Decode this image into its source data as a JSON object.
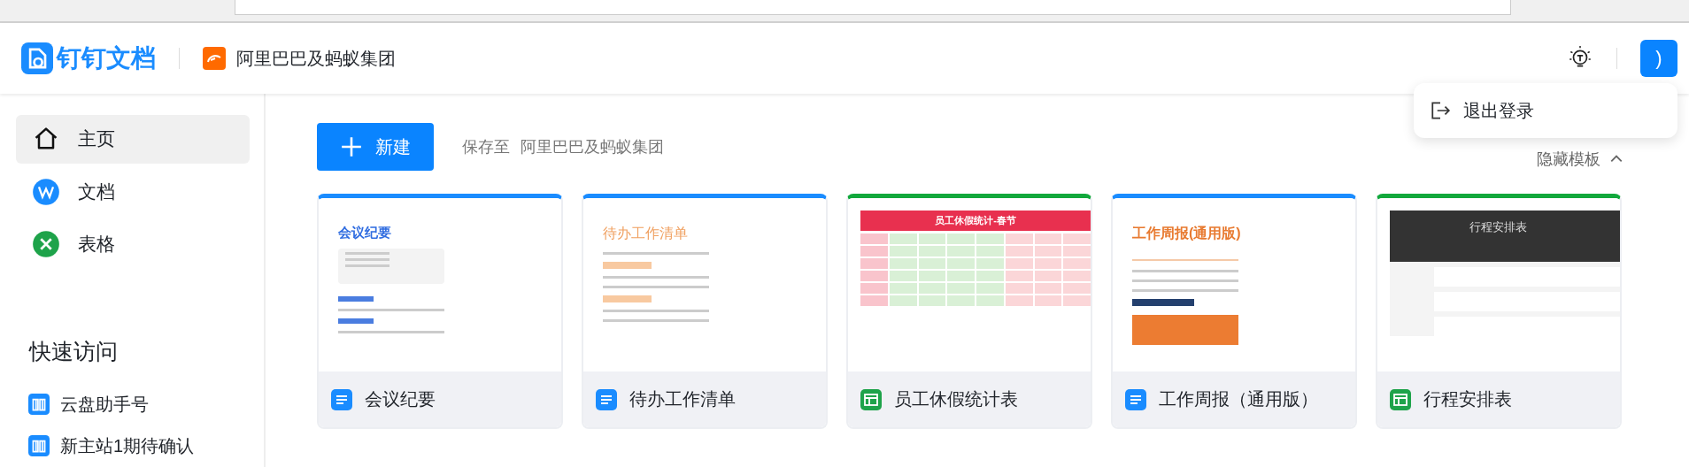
{
  "header": {
    "product": "钉钉文档",
    "organization": "阿里巴巴及蚂蚁集团",
    "avatar_text": ")"
  },
  "account_menu": {
    "items": [
      {
        "label": "退出登录"
      }
    ]
  },
  "sidebar": {
    "items": [
      {
        "label": "主页",
        "kind": "home",
        "selected": true
      },
      {
        "label": "文档",
        "kind": "doc",
        "selected": false
      },
      {
        "label": "表格",
        "kind": "sheet",
        "selected": false
      }
    ],
    "quick_access": {
      "title": "快速访问",
      "items": [
        {
          "label": "云盘助手号"
        },
        {
          "label": "新主站1期待确认"
        }
      ]
    }
  },
  "toolbar": {
    "new_button": "新建",
    "save_label": "保存至",
    "save_target": "阿里巴巴及蚂蚁集团",
    "hide_templates": "隐藏模板"
  },
  "templates": [
    {
      "name": "会议纪要",
      "kind": "doc",
      "preview_title": "会议纪要"
    },
    {
      "name": "待办工作清单",
      "kind": "doc",
      "preview_title": "待办工作清单"
    },
    {
      "name": "员工休假统计表",
      "kind": "sheet",
      "preview_title": "员工休假统计-春节"
    },
    {
      "name": "工作周报（通用版）",
      "kind": "doc",
      "preview_title": "工作周报(通用版)"
    },
    {
      "name": "行程安排表",
      "kind": "sheet",
      "preview_title": "行程安排表"
    }
  ]
}
